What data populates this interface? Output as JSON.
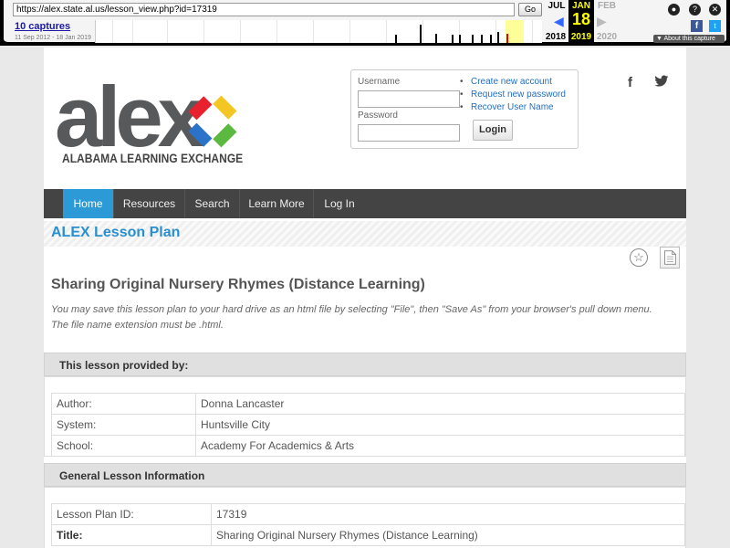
{
  "wayback": {
    "url": "https://alex.state.al.us/lesson_view.php?id=17319",
    "go_label": "Go",
    "captures_label": "10 captures",
    "range": "11 Sep 2012 - 18 Jan 2019",
    "prev_month": "JUL",
    "prev_year": "2018",
    "cur_month": "JAN",
    "cur_day": "18",
    "cur_year": "2019",
    "next_month": "FEB",
    "next_year": "2020",
    "about_label": "▼ About this capture"
  },
  "header": {
    "logo_text": "alex",
    "logo_subtitle": "ALABAMA LEARNING EXCHANGE",
    "brand_colors": [
      "#e7222e",
      "#f3c623",
      "#2a73c9",
      "#5bb93f"
    ]
  },
  "login": {
    "username_label": "Username",
    "password_label": "Password",
    "links": [
      "Create new account",
      "Request new password",
      "Recover User Name"
    ],
    "login_button": "Login"
  },
  "social": {
    "facebook_icon": "facebook-icon",
    "twitter_icon": "twitter-icon"
  },
  "nav": {
    "items": [
      "Home",
      "Resources",
      "Search",
      "Learn More",
      "Log In"
    ],
    "active": "Home",
    "accent": "#2b9ad6"
  },
  "ribbon": {
    "title": "ALEX Lesson Plan"
  },
  "lesson": {
    "title": "Sharing Original Nursery Rhymes (Distance Learning)",
    "save_note": "You may save this lesson plan to your hard drive as an html file by selecting \"File\", then \"Save As\" from your browser's pull down menu. The file name extension must be .html."
  },
  "provided_by": {
    "heading": "This lesson provided by:",
    "rows": [
      {
        "label": "Author:",
        "value": "Donna Lancaster"
      },
      {
        "label": "System:",
        "value": "Huntsville City"
      },
      {
        "label": "School:",
        "value": "Academy For Academics & Arts"
      }
    ]
  },
  "general_info": {
    "heading": "General Lesson Information",
    "rows": [
      {
        "label": "Lesson Plan ID:",
        "value": "17319"
      },
      {
        "label": "Title:",
        "value": "Sharing Original Nursery Rhymes (Distance Learning)"
      }
    ]
  }
}
